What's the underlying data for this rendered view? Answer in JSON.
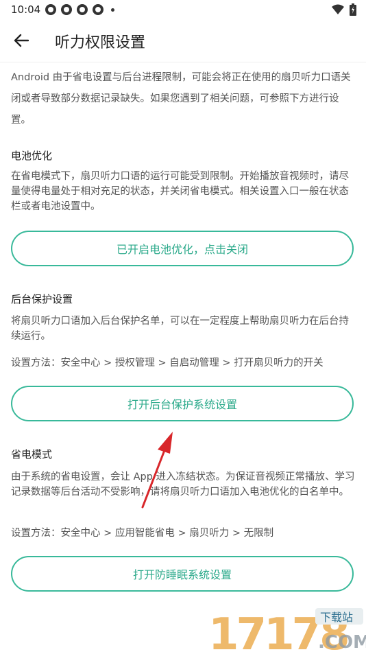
{
  "status_bar": {
    "time": "10:04"
  },
  "header": {
    "title": "听力权限设置"
  },
  "intro": {
    "text": "Android 由于省电设置与后台进程限制，可能会将正在使用的扇贝听力口语关闭或者导致部分数据记录缺失。如果您遇到了相关问题，可参照下方进行设置。"
  },
  "battery": {
    "title": "电池优化",
    "desc": "在省电模式下，扇贝听力口语的运行可能受到限制。开始播放音视频时，请尽量使得电量处于相对充足的状态，并关闭省电模式。相关设置入口一般在状态栏或者电池设置中。",
    "button_label": "已开启电池优化，点击关闭"
  },
  "background": {
    "title": "后台保护设置",
    "desc": "将扇贝听力口语加入后台保护名单，可以在一定程度上帮助扇贝听力在后台持续运行。",
    "method": "设置方法：安全中心 > 授权管理 > 自启动管理 > 打开扇贝听力的开关",
    "button_label": "打开后台保护系统设置"
  },
  "power_save": {
    "title": "省电模式",
    "desc": "由于系统的省电设置，会让 App 进入冻结状态。为保证音视频正常播放、学习记录数据等后台活动不受影响，请将扇贝听力口语加入电池优化的白名单中。",
    "method": "设置方法：安全中心 > 应用智能省电 > 扇贝听力 > 无限制",
    "button_label": "打开防睡眠系统设置"
  },
  "watermark": {
    "number": "17178",
    "badge": "下载站",
    "domain": ".COM"
  },
  "colors": {
    "accent": "#39b99a",
    "arrow": "#d8262a"
  }
}
